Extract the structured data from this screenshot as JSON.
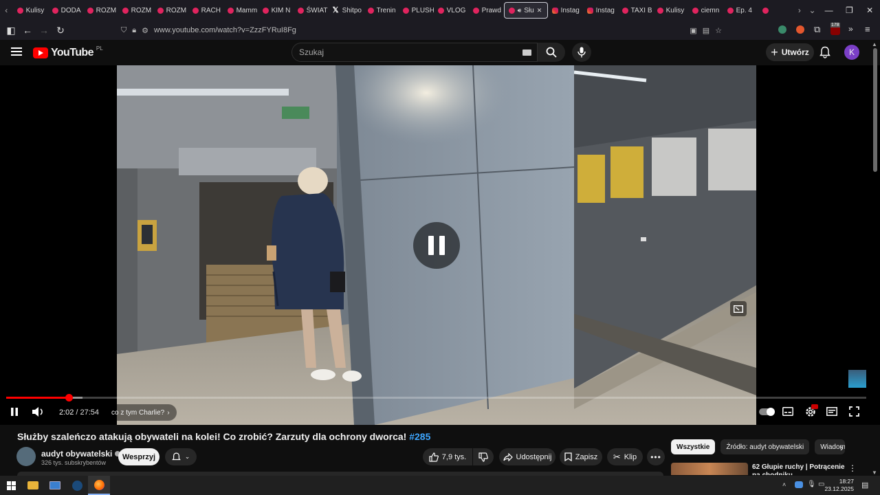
{
  "browser": {
    "tabs": [
      {
        "label": "Kulisy",
        "favicon": "youtube-favicon"
      },
      {
        "label": "DODA",
        "favicon": "youtube-favicon"
      },
      {
        "label": "ROZM",
        "favicon": "youtube-favicon"
      },
      {
        "label": "ROZM",
        "favicon": "youtube-favicon"
      },
      {
        "label": "ROZM",
        "favicon": "youtube-favicon"
      },
      {
        "label": "RACH",
        "favicon": "youtube-favicon"
      },
      {
        "label": "Mamm",
        "favicon": "youtube-favicon"
      },
      {
        "label": "KIM N",
        "favicon": "youtube-favicon"
      },
      {
        "label": "ŚWIAT",
        "favicon": "youtube-favicon"
      },
      {
        "label": "Shitpo",
        "favicon": "x-favicon"
      },
      {
        "label": "Trenin",
        "favicon": "youtube-favicon"
      },
      {
        "label": "PLUSH",
        "favicon": "youtube-favicon"
      },
      {
        "label": "VLOG",
        "favicon": "youtube-favicon"
      },
      {
        "label": "Prawd",
        "favicon": "youtube-favicon"
      },
      {
        "label": "Słu",
        "favicon": "youtube-favicon",
        "active": true
      },
      {
        "label": "Instag",
        "favicon": "instagram-favicon"
      },
      {
        "label": "Instag",
        "favicon": "instagram-favicon"
      },
      {
        "label": "TAXI B",
        "favicon": "youtube-favicon"
      },
      {
        "label": "Kulisy",
        "favicon": "youtube-favicon"
      },
      {
        "label": "ciemn",
        "favicon": "youtube-favicon"
      },
      {
        "label": "Ep. 4",
        "favicon": "youtube-favicon"
      },
      {
        "label": "",
        "favicon": "youtube-favicon"
      }
    ],
    "url": "www.youtube.com/watch?v=ZzzFYRuI8Fg",
    "extension_badge": "178"
  },
  "youtube": {
    "logo_text": "YouTube",
    "region": "PL",
    "search_placeholder": "Szukaj",
    "create_label": "Utwórz",
    "avatar_letter": "K"
  },
  "player": {
    "current_time": "2:02",
    "duration": "27:54",
    "played_fraction": 0.073,
    "buffered_fraction": 0.089,
    "chapter_label": "co z tym Charlie?",
    "state": "paused-indicator"
  },
  "video": {
    "title": "Służby szaleńczo atakują obywateli na kolei! Co zrobić? Zarzuty dla ochrony dworca!",
    "hashtag": "#285",
    "channel_name": "audyt obywatelski",
    "subscribers": "326 tys. subskrybentów",
    "support_label": "Wesprzyj",
    "likes": "7,9 tys.",
    "share_label": "Udostępnij",
    "save_label": "Zapisz",
    "clip_label": "Klip"
  },
  "recommendations": {
    "chips": [
      "Wszystkie",
      "Źródło: audyt obywatelski",
      "Wiadom"
    ],
    "first_title": "62 Głupie ruchy | Potrącenie na chodniku"
  },
  "taskbar": {
    "time": "18:27",
    "date": "23.12.2025"
  },
  "colors": {
    "youtube_red": "#ff0000",
    "progress_red": "#ff0000",
    "link_blue": "#3ea6ff",
    "avatar_purple": "#7b3fc7"
  }
}
